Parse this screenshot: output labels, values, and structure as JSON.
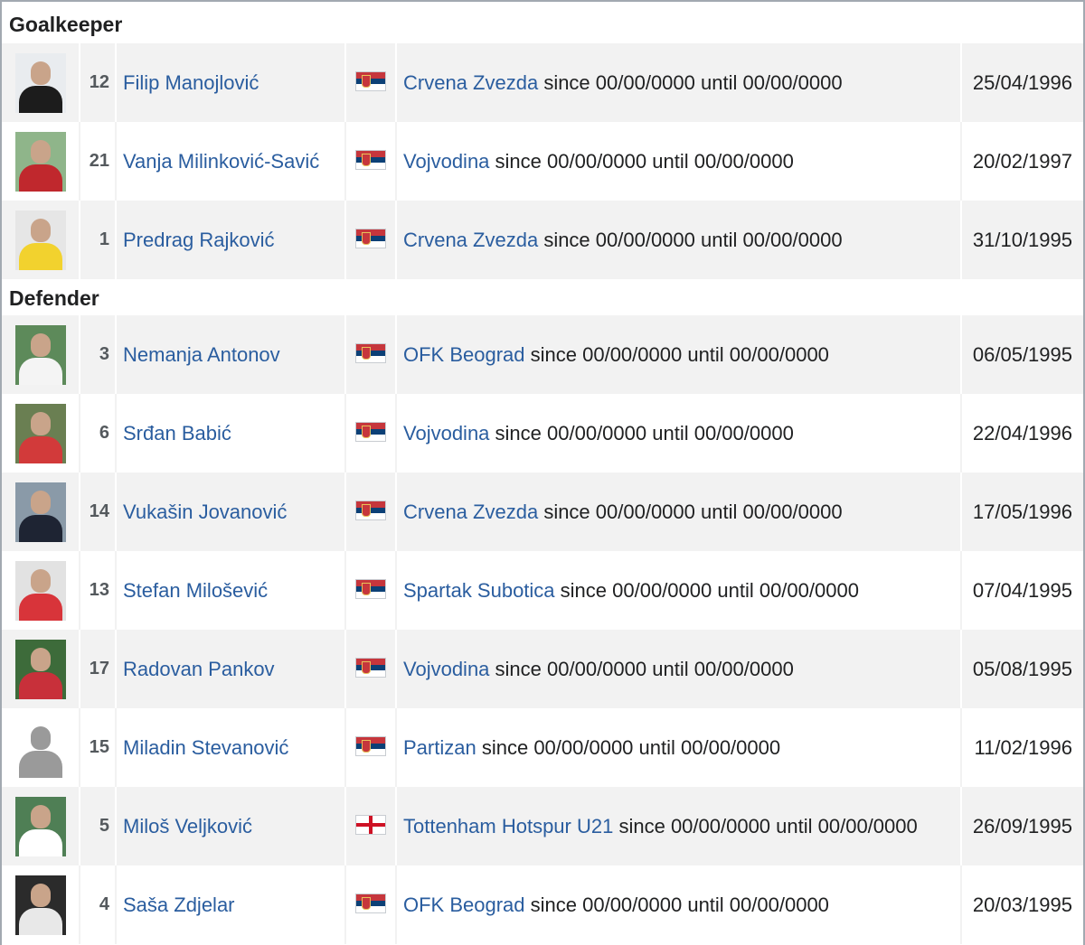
{
  "sections": [
    {
      "title": "Goalkeeper",
      "players": [
        {
          "number": "12",
          "name": "Filip Manojlović",
          "flag": "serbia-flag",
          "club": "Crvena Zvezda",
          "period": "since 00/00/0000 until 00/00/0000",
          "dob": "25/04/1996",
          "kit": "#1c1c1c",
          "bg": "#e9ecef"
        },
        {
          "number": "21",
          "name": "Vanja Milinković-Savić",
          "flag": "serbia-flag",
          "club": "Vojvodina",
          "period": "since 00/00/0000 until 00/00/0000",
          "dob": "20/02/1997",
          "kit": "#c0282d",
          "bg": "#8fb58a"
        },
        {
          "number": "1",
          "name": "Predrag Rajković",
          "flag": "serbia-flag",
          "club": "Crvena Zvezda",
          "period": "since 00/00/0000 until 00/00/0000",
          "dob": "31/10/1995",
          "kit": "#f2d22e",
          "bg": "#e6e6e6"
        }
      ]
    },
    {
      "title": "Defender",
      "players": [
        {
          "number": "3",
          "name": "Nemanja Antonov",
          "flag": "serbia-flag",
          "club": "OFK Beograd",
          "period": "since 00/00/0000 until 00/00/0000",
          "dob": "06/05/1995",
          "kit": "#f4f4f4",
          "bg": "#5d8a5a"
        },
        {
          "number": "6",
          "name": "Srđan Babić",
          "flag": "serbia-flag",
          "club": "Vojvodina",
          "period": "since 00/00/0000 until 00/00/0000",
          "dob": "22/04/1996",
          "kit": "#d23a3a",
          "bg": "#6a7f52"
        },
        {
          "number": "14",
          "name": "Vukašin Jovanović",
          "flag": "serbia-flag",
          "club": "Crvena Zvezda",
          "period": "since 00/00/0000 until 00/00/0000",
          "dob": "17/05/1996",
          "kit": "#1e2433",
          "bg": "#8a9aa8"
        },
        {
          "number": "13",
          "name": "Stefan Milošević",
          "flag": "serbia-flag",
          "club": "Spartak Subotica",
          "period": "since 00/00/0000 until 00/00/0000",
          "dob": "07/04/1995",
          "kit": "#d8343a",
          "bg": "#e2e2e2"
        },
        {
          "number": "17",
          "name": "Radovan Pankov",
          "flag": "serbia-flag",
          "club": "Vojvodina",
          "period": "since 00/00/0000 until 00/00/0000",
          "dob": "05/08/1995",
          "kit": "#c8303a",
          "bg": "#3d6b3a"
        },
        {
          "number": "15",
          "name": "Miladin Stevanović",
          "flag": "serbia-flag",
          "club": "Partizan",
          "period": "since 00/00/0000 until 00/00/0000",
          "dob": "11/02/1996",
          "kit": "silhouette",
          "bg": "#ffffff"
        },
        {
          "number": "5",
          "name": "Miloš Veljković",
          "flag": "england-flag",
          "club": "Tottenham Hotspur U21",
          "period": "since 00/00/0000 until 00/00/0000",
          "dob": "26/09/1995",
          "kit": "#ffffff",
          "bg": "#4f7f55"
        },
        {
          "number": "4",
          "name": "Saša Zdjelar",
          "flag": "serbia-flag",
          "club": "OFK Beograd",
          "period": "since 00/00/0000 until 00/00/0000",
          "dob": "20/03/1995",
          "kit": "#e8e8e8",
          "bg": "#2b2b2b"
        }
      ]
    }
  ]
}
